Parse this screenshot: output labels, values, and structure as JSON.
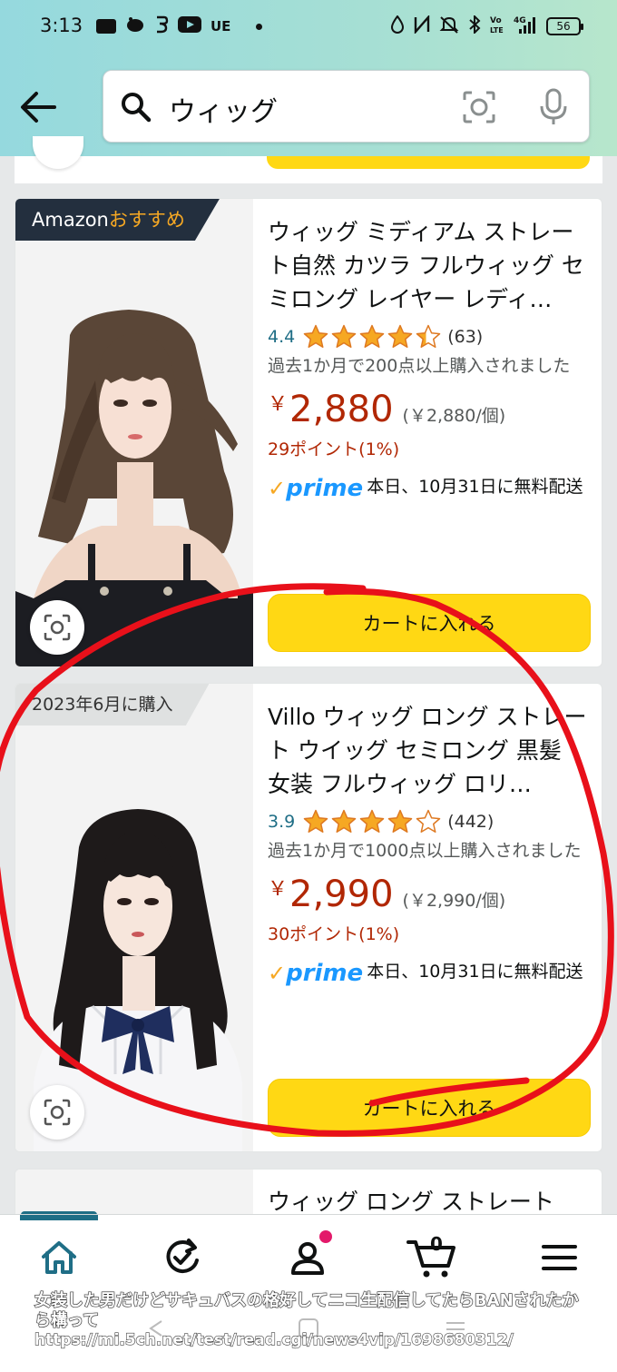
{
  "status_bar": {
    "time": "3:13",
    "left_icons": [
      "tv-icon",
      "piggy-icon",
      "app-icon",
      "youtube-icon",
      "UE"
    ],
    "right_icons": [
      "drop-icon",
      "nfc-icon",
      "mute-icon",
      "bluetooth-icon",
      "volte-icon",
      "signal-4g-icon"
    ],
    "carrier_tag": "UE",
    "battery": "56"
  },
  "search": {
    "query": "ウィッグ"
  },
  "products": [
    {
      "badge_prefix": "Amazon",
      "badge_suffix": "おすすめ",
      "title": "ウィッグ ミディアム ストレート自然 カツラ フルウィッグ セミロング レイヤー レディ…",
      "rating": "4.4",
      "stars": 4.4,
      "review_count": "(63)",
      "bought": "過去1か月で200点以上購入されました",
      "yen": "￥",
      "price": "2,880",
      "unit_price": "(￥2,880/個)",
      "points": "29ポイント(1%)",
      "prime_word": "prime",
      "delivery": "本日、10月31日に無料配送",
      "cart_label": "カートに入れる"
    },
    {
      "badge": "2023年6月に購入",
      "title": "Villo ウィッグ ロング ストレート ウイッグ セミロング 黒髪 女装 フルウィッグ ロリ…",
      "rating": "3.9",
      "stars": 3.9,
      "review_count": "(442)",
      "bought": "過去1か月で1000点以上購入されました",
      "yen": "￥",
      "price": "2,990",
      "unit_price": "(￥2,990/個)",
      "points": "30ポイント(1%)",
      "prime_word": "prime",
      "delivery": "本日、10月31日に無料配送",
      "cart_label": "カートに入れる"
    },
    {
      "title": "ウィッグ ロング ストレート"
    }
  ],
  "bottom_nav": [
    "home-icon",
    "refresh-check-icon",
    "account-icon",
    "cart-icon",
    "menu-icon"
  ],
  "cart_count": "0",
  "caption": {
    "text": "女装した男だけどサキュバスの格好してニコ生配信してたらBANされたから構って",
    "url": "https://mi.5ch.net/test/read.cgi/news4vip/1698680312/"
  },
  "colors": {
    "header_gradient": [
      "#95d9de",
      "#b7e6cc"
    ],
    "price": "#b12704",
    "cart_button": "#ffd814",
    "rating": "#1f6e86",
    "star": "#f6a823",
    "annotation": "#e8101a"
  }
}
